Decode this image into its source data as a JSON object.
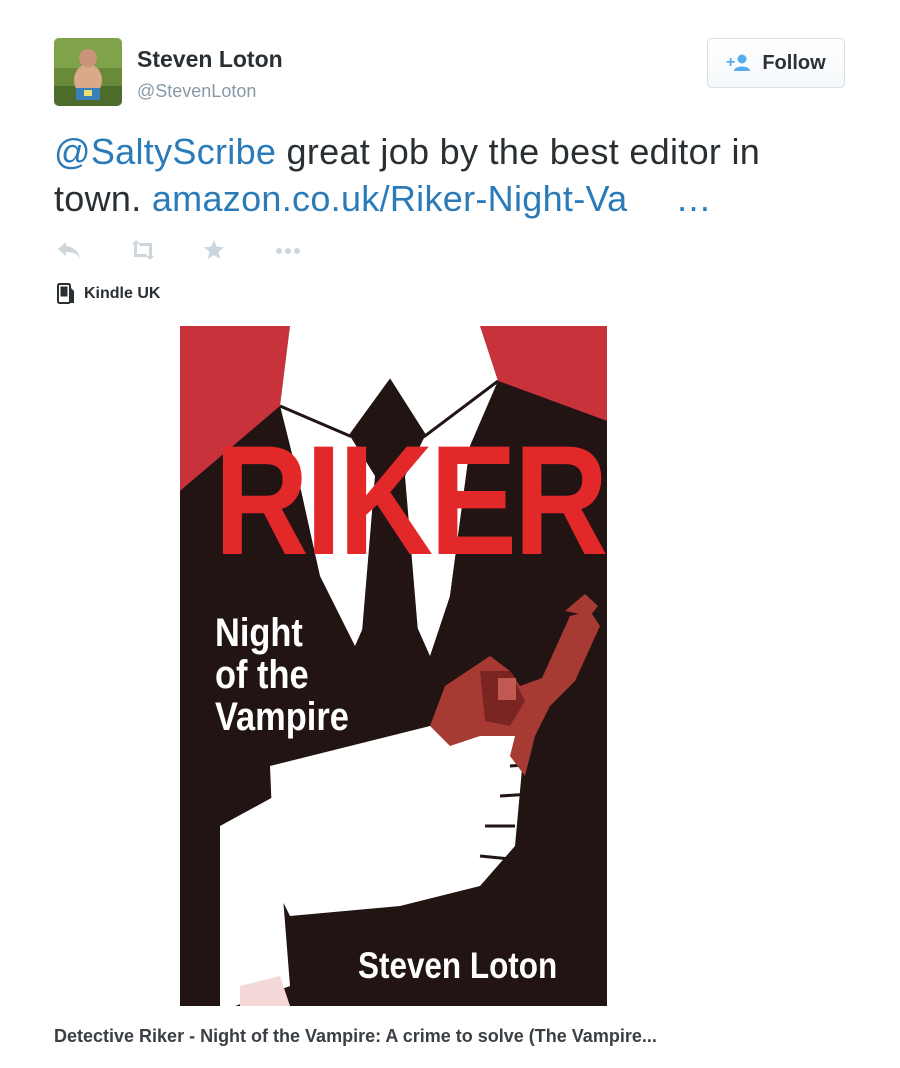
{
  "user": {
    "name": "Steven Loton",
    "handle": "@StevenLoton"
  },
  "follow_button": {
    "label": "Follow",
    "icon": "follow-person-plus-icon"
  },
  "tweet": {
    "mention": "@SaltyScribe",
    "text_part1": " great job by the best editor in town. ",
    "link": "amazon.co.uk/Riker-Night-Va",
    "ellipsis": "…"
  },
  "actions": [
    {
      "name": "reply-icon"
    },
    {
      "name": "retweet-icon"
    },
    {
      "name": "favorite-star-icon"
    },
    {
      "name": "more-dots-icon"
    }
  ],
  "source": {
    "label": "Kindle UK",
    "icon": "kindle-device-icon"
  },
  "card": {
    "cover_title": "RIKER",
    "cover_subtitle_line1": "Night",
    "cover_subtitle_line2": "of the",
    "cover_subtitle_line3": "Vampire",
    "cover_author": "Steven Loton",
    "caption": "Detective Riker - Night of the Vampire: A crime to solve (The Vampire..."
  },
  "colors": {
    "link": "#2b7bb9",
    "handle": "#8899a6",
    "action_icons": "#ccd6dd",
    "cover_red": "#c8323a",
    "cover_dark": "#231414",
    "cover_title_red": "#e3282a"
  }
}
